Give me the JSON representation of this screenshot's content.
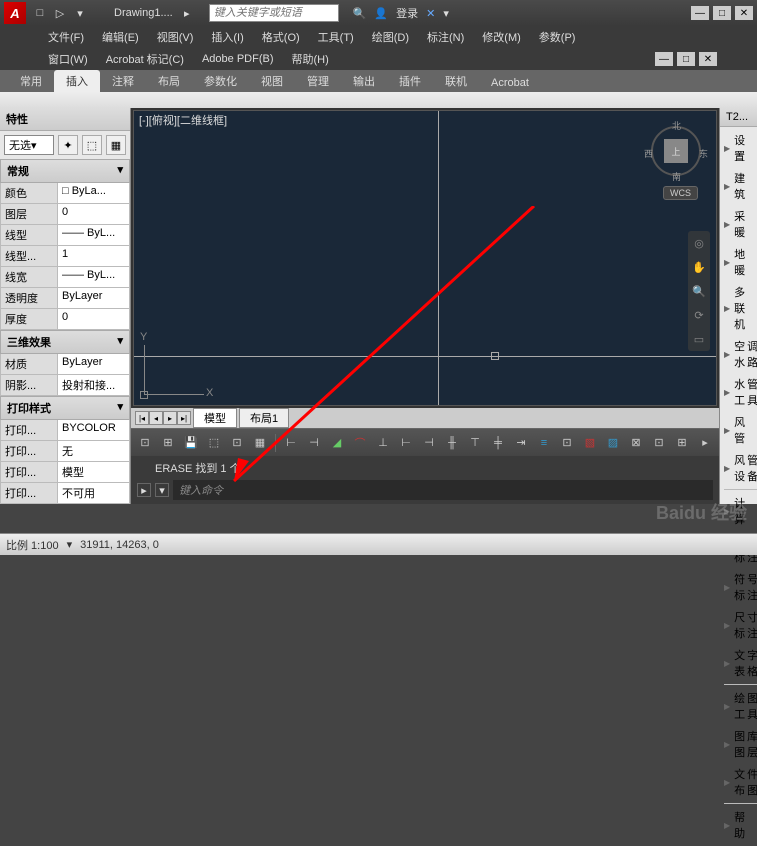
{
  "title": {
    "doc": "Drawing1....",
    "login": "登录"
  },
  "search": {
    "placeholder": "键入关键字或短语"
  },
  "menus1": [
    "文件(F)",
    "编辑(E)",
    "视图(V)",
    "插入(I)",
    "格式(O)",
    "工具(T)",
    "绘图(D)",
    "标注(N)",
    "修改(M)",
    "参数(P)"
  ],
  "menus2": [
    "窗口(W)",
    "Acrobat 标记(C)",
    "Adobe PDF(B)",
    "帮助(H)"
  ],
  "ribbon": {
    "tabs": [
      "常用",
      "插入",
      "注释",
      "布局",
      "参数化",
      "视图",
      "管理",
      "输出",
      "插件",
      "联机",
      "Acrobat"
    ],
    "active": 1
  },
  "props": {
    "title": "特性",
    "filter": "无选",
    "sections": {
      "general": {
        "title": "常规",
        "rows": [
          {
            "k": "颜色",
            "v": "□ ByLa..."
          },
          {
            "k": "图层",
            "v": "0"
          },
          {
            "k": "线型",
            "v": "—— ByL..."
          },
          {
            "k": "线型...",
            "v": "1"
          },
          {
            "k": "线宽",
            "v": "—— ByL..."
          },
          {
            "k": "透明度",
            "v": "ByLayer"
          },
          {
            "k": "厚度",
            "v": "0"
          }
        ]
      },
      "threed": {
        "title": "三维效果",
        "rows": [
          {
            "k": "材质",
            "v": "ByLayer"
          },
          {
            "k": "阴影...",
            "v": "投射和接..."
          }
        ]
      },
      "print": {
        "title": "打印样式",
        "rows": [
          {
            "k": "打印...",
            "v": "BYCOLOR"
          },
          {
            "k": "打印...",
            "v": "无"
          },
          {
            "k": "打印...",
            "v": "模型"
          },
          {
            "k": "打印...",
            "v": "不可用"
          }
        ]
      }
    }
  },
  "viewport": {
    "label": "[-][俯视][二维线框]",
    "wcs": "WCS",
    "ucs": {
      "x": "X",
      "y": "Y"
    },
    "cube": {
      "n": "北",
      "s": "南",
      "e": "东",
      "w": "西",
      "top": "上"
    }
  },
  "layoutTabs": {
    "model": "模型",
    "layout1": "布局1"
  },
  "cmd": {
    "history": "ERASE 找到 1 个",
    "placeholder": "键入命令"
  },
  "right": {
    "title": "T2...",
    "items": [
      "设　置",
      "建　筑",
      "采　暖",
      "地　暖",
      "多 联 机",
      "空调水路",
      "水管工具",
      "风　管",
      "风管设备"
    ],
    "items2": [
      "计　算",
      "专业标注",
      "符号标注",
      "尺寸标注",
      "文字表格"
    ],
    "items3": [
      "绘图工具",
      "图库图层",
      "文件布图"
    ],
    "items4": [
      "帮　助"
    ]
  },
  "status": {
    "scale": "比例 1:100",
    "coords": "31911, 14263, 0"
  }
}
